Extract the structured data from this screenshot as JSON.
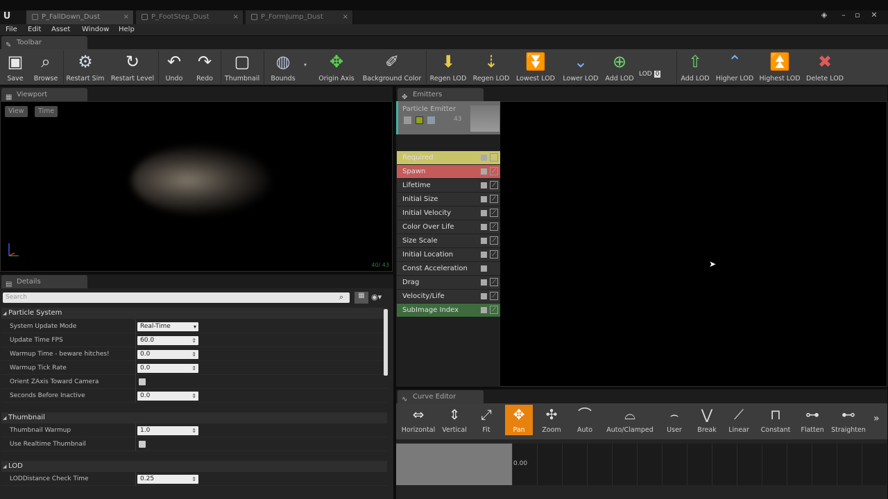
{
  "title_tabs": [
    {
      "label": "P_FallDown_Dust"
    },
    {
      "label": "P_FootStep_Dust"
    },
    {
      "label": "P_FormJump_Dust"
    }
  ],
  "menu": [
    "File",
    "Edit",
    "Asset",
    "Window",
    "Help"
  ],
  "toolbar_tab": "Toolbar",
  "toolbar": {
    "save": "Save",
    "browse": "Browse",
    "restart_sim": "Restart Sim",
    "restart_level": "Restart Level",
    "undo": "Undo",
    "redo": "Redo",
    "thumbnail": "Thumbnail",
    "bounds": "Bounds",
    "origin_axis": "Origin Axis",
    "background_color": "Background Color",
    "regen_lod_1": "Regen LOD",
    "regen_lod_2": "Regen LOD",
    "lowest_lod": "Lowest LOD",
    "lower_lod": "Lower LOD",
    "add_lod_1": "Add LOD",
    "lod_label": "LOD",
    "lod_value": "0",
    "add_lod_2": "Add LOD",
    "higher_lod": "Higher LOD",
    "highest_lod": "Highest LOD",
    "delete_lod": "Delete LOD"
  },
  "viewport": {
    "tab": "Viewport",
    "view_btn": "View",
    "time_btn": "Time",
    "counter": "40/ 43"
  },
  "details": {
    "tab": "Details",
    "search_placeholder": "Search",
    "categories": {
      "particle_system": "Particle System",
      "thumbnail": "Thumbnail",
      "lod": "LOD"
    },
    "props": {
      "system_update_mode": {
        "label": "System Update Mode",
        "value": "Real-Time"
      },
      "update_time_fps": {
        "label": "Update Time FPS",
        "value": "60.0"
      },
      "warmup_time": {
        "label": "Warmup Time - beware hitches!",
        "value": "0.0"
      },
      "warmup_tick_rate": {
        "label": "Warmup Tick Rate",
        "value": "0.0"
      },
      "orient_zaxis": {
        "label": "Orient ZAxis Toward Camera"
      },
      "seconds_before_inactive": {
        "label": "Seconds Before Inactive",
        "value": "0.0"
      },
      "thumbnail_warmup": {
        "label": "Thumbnail Warmup",
        "value": "1.0"
      },
      "use_realtime_thumbnail": {
        "label": "Use Realtime Thumbnail"
      },
      "lod_distance_check_time": {
        "label": "LODDistance Check Time",
        "value": "0.25"
      }
    }
  },
  "emitters": {
    "tab": "Emitters",
    "emitter_name": "Particle Emitter",
    "emitter_count": "43",
    "modules": [
      {
        "label": "Required",
        "color": "#c9c46a"
      },
      {
        "label": "Spawn",
        "color": "#c45a5a"
      },
      {
        "label": "Lifetime"
      },
      {
        "label": "Initial Size"
      },
      {
        "label": "Initial Velocity"
      },
      {
        "label": "Color Over Life"
      },
      {
        "label": "Size Scale"
      },
      {
        "label": "Initial Location"
      },
      {
        "label": "Const Acceleration"
      },
      {
        "label": "Drag"
      },
      {
        "label": "Velocity/Life"
      },
      {
        "label": "SubImage Index",
        "color": "#3e6b3e"
      }
    ]
  },
  "curve_editor": {
    "tab": "Curve Editor",
    "buttons": {
      "horizontal": "Horizontal",
      "vertical": "Vertical",
      "fit": "Fit",
      "pan": "Pan",
      "zoom": "Zoom",
      "auto": "Auto",
      "auto_clamped": "Auto/Clamped",
      "user": "User",
      "break": "Break",
      "linear": "Linear",
      "constant": "Constant",
      "flatten": "Flatten",
      "straighten": "Straighten"
    },
    "grid_value": "0.00"
  }
}
